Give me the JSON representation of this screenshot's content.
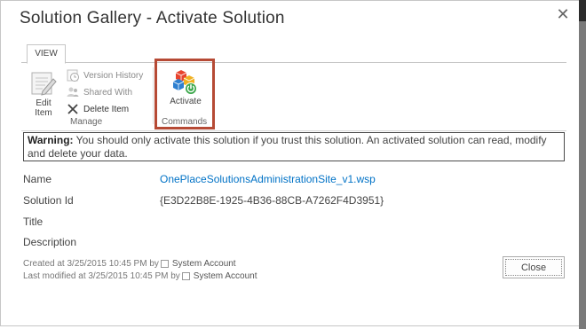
{
  "dialog": {
    "title": "Solution Gallery - Activate Solution",
    "close_icon": "close-icon"
  },
  "ribbon": {
    "tab_label": "VIEW",
    "manage": {
      "edit_item_line1": "Edit",
      "edit_item_line2": "Item",
      "version_history": "Version History",
      "shared_with": "Shared With",
      "delete_item": "Delete Item",
      "group_label": "Manage"
    },
    "commands": {
      "activate": "Activate",
      "group_label": "Commands",
      "highlight_color": "#b64a35"
    }
  },
  "warning": {
    "label": "Warning:",
    "text": "You should only activate this solution if you trust this solution. An activated solution can read, modify and delete your data."
  },
  "fields": {
    "name_label": "Name",
    "name_value": "OnePlaceSolutionsAdministrationSite_v1.wsp",
    "solution_id_label": "Solution Id",
    "solution_id_value": "{E3D22B8E-1925-4B36-88CB-A7262F4D3951}",
    "title_label": "Title",
    "description_label": "Description"
  },
  "meta": {
    "created_prefix": "Created at 3/25/2015 10:45 PM  by",
    "created_by": "System Account",
    "modified_prefix": "Last modified at 3/25/2015 10:45 PM  by",
    "modified_by": "System Account"
  },
  "footer": {
    "close_label": "Close"
  },
  "colors": {
    "link": "#0072c6",
    "border": "#c6c6c6"
  }
}
